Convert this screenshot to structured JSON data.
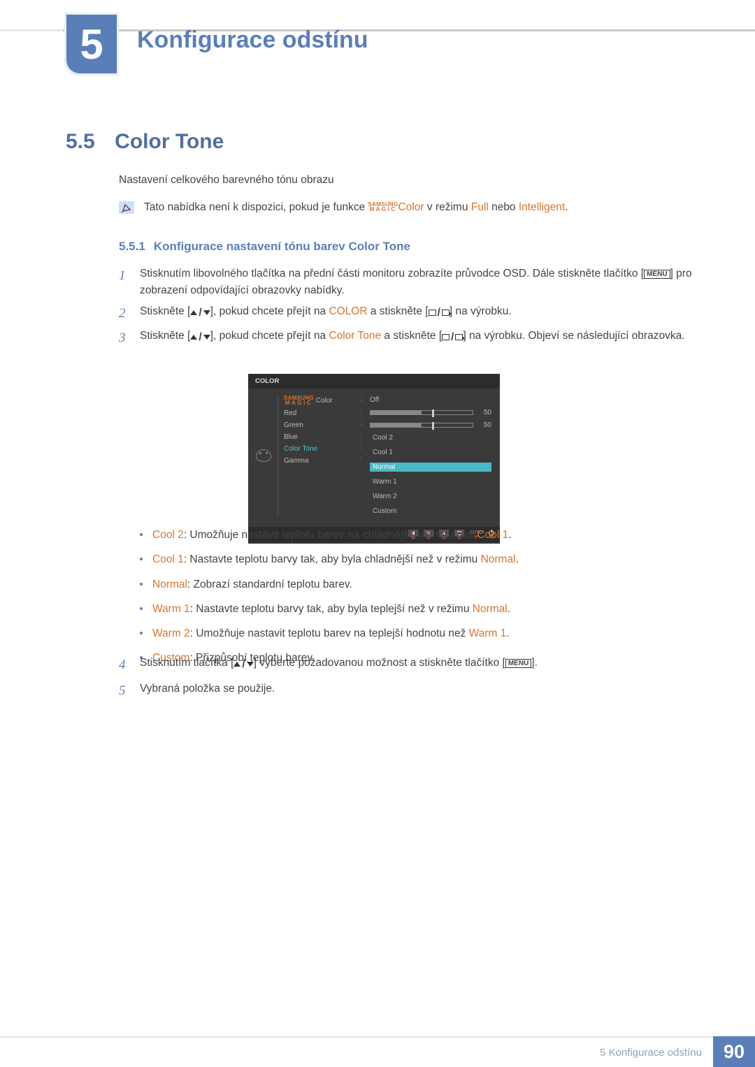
{
  "chapter": {
    "number": "5",
    "title": "Konfigurace odstínu"
  },
  "section": {
    "number": "5.5",
    "title": "Color Tone"
  },
  "intro": "Nastavení celkového barevného tónu obrazu",
  "note": {
    "pre": "Tato nabídka není k dispozici, pokud je funkce ",
    "magic_top": "SAMSUNG",
    "magic_bot": "MAGIC",
    "color": "Color",
    "mid": " v režimu ",
    "full": "Full",
    "or": " nebo ",
    "intelligent": "Intelligent",
    "end": "."
  },
  "subsection": {
    "number": "5.5.1",
    "title": "Konfigurace nastavení tónu barev Color Tone"
  },
  "menu_label": "MENU",
  "steps": {
    "s1a": "Stisknutím libovolného tlačítka na přední části monitoru zobrazíte průvodce OSD. Dále stiskněte tlačítko [",
    "s1b": "] pro zobrazení odpovídající obrazovky nabídky.",
    "s2a": "Stiskněte [",
    "s2b": "], pokud chcete přejít na ",
    "s2_color": "COLOR",
    "s2c": " a stiskněte [",
    "s2d": "] na výrobku.",
    "s3a": "Stiskněte [",
    "s3b": "], pokud chcete přejít na ",
    "s3_ct": "Color Tone",
    "s3c": " a stiskněte [",
    "s3d": "] na výrobku. Objeví se následující obrazovka.",
    "s4a": "Stisknutím tlačítka [",
    "s4b": "] vyberte požadovanou možnost a stiskněte tlačítko [",
    "s4c": "].",
    "s5": "Vybraná položka se použije."
  },
  "osd": {
    "title": "COLOR",
    "labels": {
      "magic": " Color",
      "magic_top": "SAMSUNG",
      "magic_bot": "MAGIC",
      "red": "Red",
      "green": "Green",
      "blue": "Blue",
      "color_tone": "Color Tone",
      "gamma": "Gamma"
    },
    "values": {
      "magic": "Off",
      "red": "50",
      "green": "50"
    },
    "options": [
      "Cool 2",
      "Cool 1",
      "Normal",
      "Warm 1",
      "Warm 2",
      "Custom"
    ],
    "selected": "Normal",
    "auto": "AUTO"
  },
  "bullets": {
    "cool2": {
      "label": "Cool 2",
      "text": ": Umožňuje nastavit teplotu barev na chladnější hodnotu než ",
      "ref": "Cool 1",
      "end": "."
    },
    "cool1": {
      "label": "Cool 1",
      "text": ": Nastavte teplotu barvy tak, aby byla chladnější než v režimu ",
      "ref": "Normal",
      "end": "."
    },
    "normal": {
      "label": "Normal",
      "text": ": Zobrazí standardní teplotu barev."
    },
    "warm1": {
      "label": "Warm 1",
      "text": ": Nastavte teplotu barvy tak, aby byla teplejší než v režimu ",
      "ref": "Normal",
      "end": "."
    },
    "warm2": {
      "label": "Warm 2",
      "text": ": Umožňuje nastavit teplotu barev na teplejší hodnotu než ",
      "ref": "Warm 1",
      "end": "."
    },
    "custom": {
      "label": "Custom",
      "text": ": Přizpůsobí teplotu barev."
    }
  },
  "footer": {
    "text": "5 Konfigurace odstínu",
    "page": "90"
  }
}
